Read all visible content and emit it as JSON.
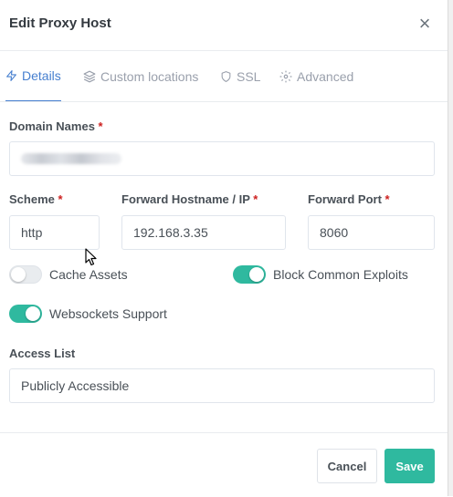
{
  "modal": {
    "title": "Edit Proxy Host"
  },
  "tabs": [
    {
      "label": "Details",
      "icon": "bolt-icon",
      "active": true
    },
    {
      "label": "Custom locations",
      "icon": "layers-icon",
      "active": false
    },
    {
      "label": "SSL",
      "icon": "shield-icon",
      "active": false
    },
    {
      "label": "Advanced",
      "icon": "gear-icon",
      "active": false
    }
  ],
  "form": {
    "domain_names": {
      "label": "Domain Names",
      "required_mark": "*"
    },
    "scheme": {
      "label": "Scheme",
      "required_mark": "*",
      "value": "http"
    },
    "forward_hostname": {
      "label": "Forward Hostname / IP",
      "required_mark": "*",
      "value": "192.168.3.35"
    },
    "forward_port": {
      "label": "Forward Port",
      "required_mark": "*",
      "value": "8060"
    },
    "cache_assets": {
      "label": "Cache Assets",
      "enabled": false
    },
    "block_exploits": {
      "label": "Block Common Exploits",
      "enabled": true
    },
    "websockets": {
      "label": "Websockets Support",
      "enabled": true
    },
    "access_list": {
      "label": "Access List",
      "value": "Publicly Accessible"
    }
  },
  "footer": {
    "cancel_label": "Cancel",
    "save_label": "Save"
  },
  "colors": {
    "accent": "#467fcf",
    "toggle_on": "#2fb99f",
    "required": "#cd201f"
  }
}
